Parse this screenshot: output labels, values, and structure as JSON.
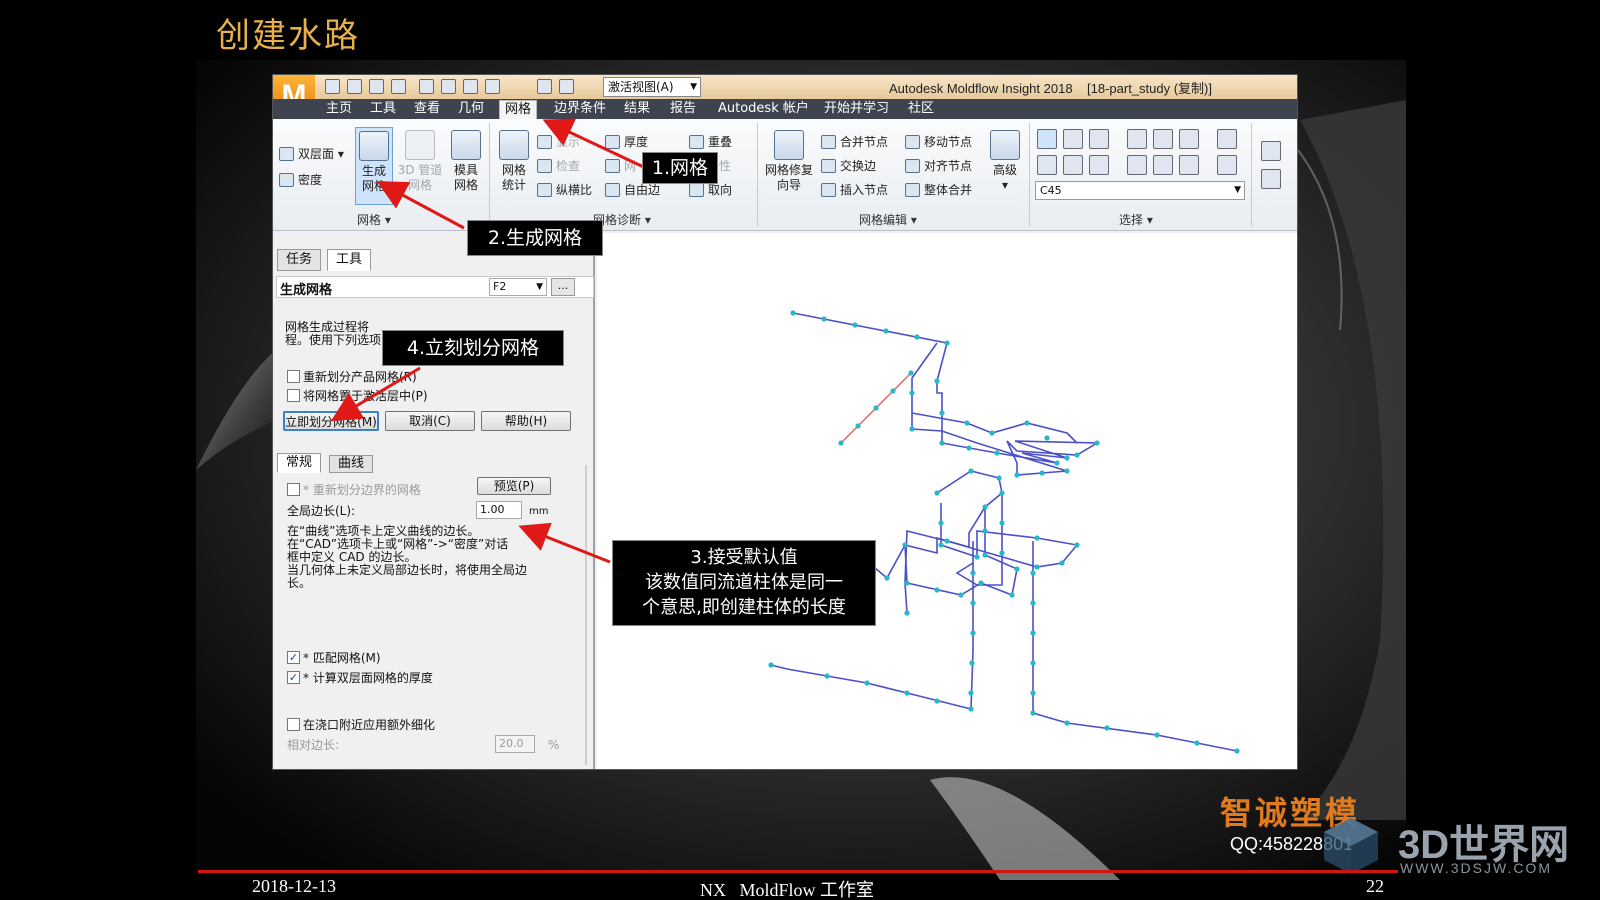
{
  "slide": {
    "title": "创建水路",
    "footer_date": "2018-12-13",
    "footer_center": "NX   MoldFlow 工作室",
    "page_number": "22",
    "brand": "智诚塑模",
    "qq": "QQ:458228801",
    "watermark": "3D世界网",
    "watermark_url": "WWW.3DSJW.COM"
  },
  "app": {
    "logo": "M",
    "view_select": "激活视图(A)",
    "window_title": "Autodesk Moldflow Insight 2018",
    "project": "[18-part_study (复制)]",
    "menu": [
      "主页",
      "工具",
      "查看",
      "几何",
      "网格",
      "边界条件",
      "结果",
      "报告",
      "Autodesk 帐户",
      "开始并学习",
      "社区"
    ]
  },
  "ribbon": {
    "mesh_group": {
      "double_layer": "双层面",
      "density": "密度",
      "generate_mesh": "生成\n网格",
      "pipe_3d": "3D 管道\n网格",
      "mold_mesh": "模具\n网格",
      "label": "网格"
    },
    "diag_group": {
      "mesh_stats": "网格\n统计",
      "display": "显示",
      "check": "检查",
      "aspect": "纵横比",
      "thickness": "厚度",
      "mesh": "网",
      "free_edge": "自由边",
      "overlap": "重叠",
      "props": "性",
      "orient": "取向",
      "label": "网格诊断"
    },
    "edit_group": {
      "repair_wizard": "网格修复\n向导",
      "merge_nodes": "合并节点",
      "swap_edge": "交换边",
      "insert_node": "插入节点",
      "move_node": "移动节点",
      "align_nodes": "对齐节点",
      "global_merge": "整体合并",
      "advanced": "高级",
      "label": "网格编辑"
    },
    "select_group": {
      "combo": "C45",
      "label": "选择"
    }
  },
  "panel": {
    "tabs": [
      "任务",
      "工具"
    ],
    "header": "生成网格",
    "shortcut": "F2",
    "dots": "...",
    "desc_lines": [
      "网格生成过程将",
      "程。使用下列选项"
    ],
    "cb_remesh_part": "重新划分产品网格(R)",
    "cb_active_layer": "将网格置于激活层中(P)",
    "btn_mesh_now": "立即划分网格(M)",
    "btn_cancel": "取消(C)",
    "btn_help": "帮助(H)",
    "subtabs": [
      "常规",
      "曲线"
    ],
    "cb_remesh_boundary": "* 重新划分边界的网格",
    "btn_preview": "预览(P)",
    "global_edge_label": "全局边长(L):",
    "global_edge_value": "1.00",
    "global_edge_unit": "mm",
    "note_lines": [
      "在“曲线”选项卡上定义曲线的边长。",
      "在“CAD”选项卡上或“网格”->“密度”对话",
      "框中定义 CAD 的边长。",
      "当几何体上未定义局部边长时，将使用全局边",
      "长。"
    ],
    "cb_match_mesh": "* 匹配网格(M)",
    "cb_calc_thickness": "* 计算双层面网格的厚度",
    "cb_gate_refine": "在浇口附近应用额外细化",
    "relative_edge_label": "相对边长:",
    "relative_edge_value": "20.0",
    "relative_edge_unit": "%"
  },
  "callouts": {
    "c1": "1.网格",
    "c2": "2.生成网格",
    "c3_lines": [
      "3.接受默认值",
      "该数值同流道柱体是同一",
      "个意思,即创建柱体的长度"
    ],
    "c4": "4.立刻划分网格"
  },
  "colors": {
    "accent": "#e8b04a",
    "brand": "#e07a1c",
    "arrow": "#e01818",
    "pipe": "#4a50c8",
    "node": "#27b7c8",
    "footer_line": "#d01515"
  }
}
